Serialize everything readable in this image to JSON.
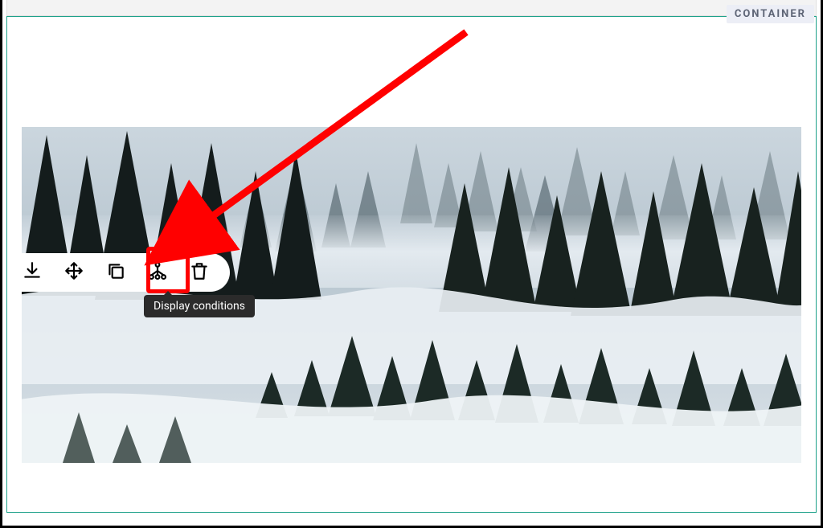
{
  "container": {
    "tag_label": "CONTAINER"
  },
  "toolbar": {
    "tools": [
      {
        "name": "save",
        "icon": "download-icon"
      },
      {
        "name": "move",
        "icon": "move-icon"
      },
      {
        "name": "copy",
        "icon": "copy-icon"
      },
      {
        "name": "display-conditions",
        "icon": "tree-icon"
      },
      {
        "name": "delete",
        "icon": "trash-icon"
      }
    ]
  },
  "tooltip": {
    "text": "Display conditions"
  },
  "annotation": {
    "arrow_color": "#ff0000",
    "highlight_color": "#ff0000"
  },
  "hero": {
    "description": "Misty forest with silhouetted evergreen trees and fog layers"
  }
}
